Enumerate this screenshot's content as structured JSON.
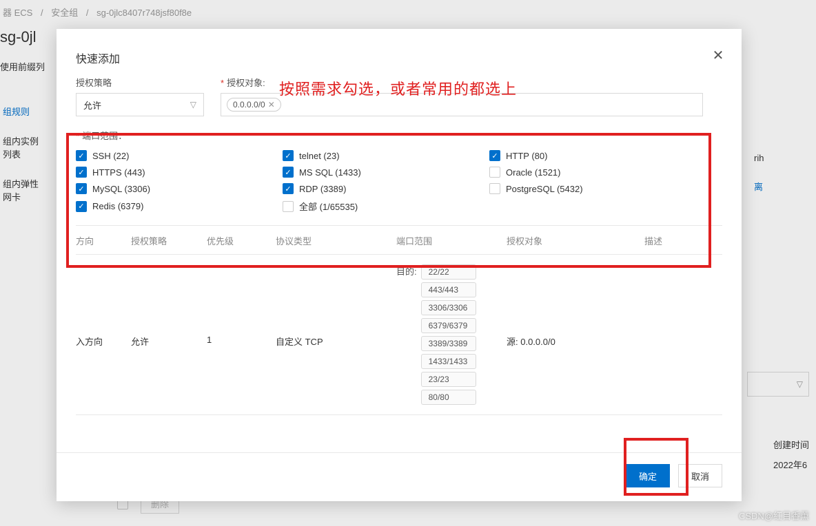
{
  "breadcrumb": {
    "part1": "器 ECS",
    "part2": "安全组",
    "part3": "sg-0jlc8407r748jsf80f8e"
  },
  "page_title": "sg-0jl",
  "toolbar": {
    "prefix_list": "使用前缀列"
  },
  "sidebar": {
    "rules": "组规则",
    "instances": "组内实例列表",
    "eni": "组内弹性网卡"
  },
  "right_side": {
    "text1": "rih",
    "link_text": "离"
  },
  "bg_bottom": {
    "create_time": "创建时间",
    "date": "2022年6"
  },
  "bg_delete": "删除",
  "modal": {
    "title": "快速添加",
    "auth_policy_label": "授权策略",
    "auth_policy_value": "允许",
    "auth_target_label": "授权对象:",
    "auth_target_tag": "0.0.0.0/0",
    "port_range_label": "端口范围：",
    "ports": [
      {
        "label": "SSH (22)",
        "checked": true
      },
      {
        "label": "telnet (23)",
        "checked": true
      },
      {
        "label": "HTTP (80)",
        "checked": true
      },
      {
        "label": "HTTPS (443)",
        "checked": true
      },
      {
        "label": "MS SQL (1433)",
        "checked": true
      },
      {
        "label": "Oracle (1521)",
        "checked": false
      },
      {
        "label": "MySQL (3306)",
        "checked": true
      },
      {
        "label": "RDP (3389)",
        "checked": true
      },
      {
        "label": "PostgreSQL (5432)",
        "checked": false
      },
      {
        "label": "Redis (6379)",
        "checked": true
      },
      {
        "label": "全部 (1/65535)",
        "checked": false
      }
    ],
    "table": {
      "headers": {
        "dir": "方向",
        "pol": "授权策略",
        "pri": "优先级",
        "proto": "协议类型",
        "port": "端口范围",
        "src": "授权对象",
        "desc": "描述"
      },
      "row": {
        "dir": "入方向",
        "pol": "允许",
        "pri": "1",
        "proto": "自定义 TCP",
        "port_label": "目的:",
        "port_tags": [
          "22/22",
          "443/443",
          "3306/3306",
          "6379/6379",
          "3389/3389",
          "1433/1433",
          "23/23",
          "80/80"
        ],
        "src": "源: 0.0.0.0/0"
      }
    },
    "footer": {
      "ok": "确定",
      "cancel": "取消"
    }
  },
  "annotation_text": "按照需求勾选，或者常用的都选上",
  "watermark": "CSDN@红目香薰"
}
